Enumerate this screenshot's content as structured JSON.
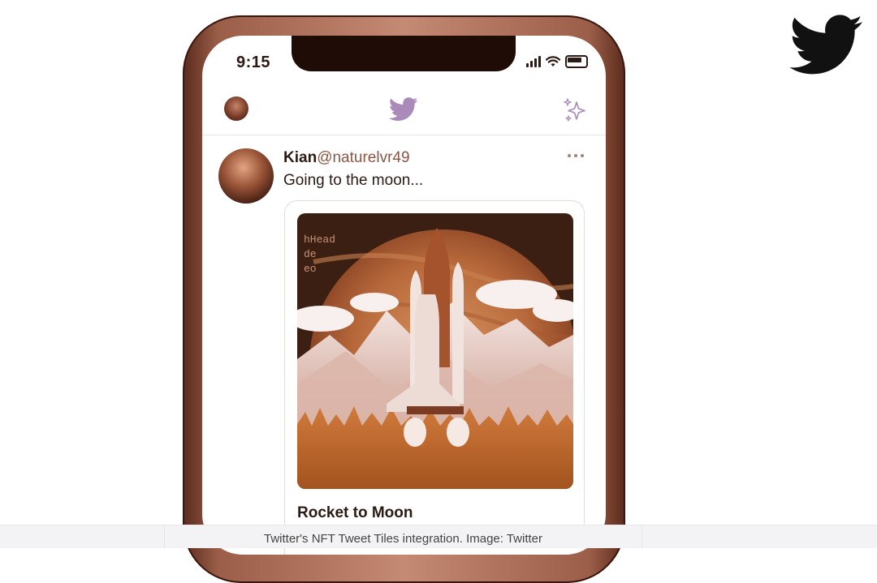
{
  "brand": {
    "icon": "twitter-bird-icon",
    "color": "#111111"
  },
  "phone": {
    "status_time": "9:15",
    "status_icons": [
      "signal-icon",
      "wifi-icon",
      "battery-icon"
    ],
    "header": {
      "avatar": "avatar",
      "logo_icon": "twitter-bird-icon",
      "logo_color": "#a98ab8",
      "sparkle_icon": "sparkle-icon"
    },
    "tweet": {
      "name": "Kian",
      "handle": "@naturelvr49",
      "text": "Going to the moon...",
      "more_icon": "more-dots-icon",
      "nft_card": {
        "image": "rocket-launch-nft-image",
        "image_code_text": [
          "hHead",
          "de",
          "eo"
        ],
        "title": "Rocket to Moon"
      }
    }
  },
  "caption": "Twitter's NFT Tweet Tiles integration. Image: Twitter"
}
